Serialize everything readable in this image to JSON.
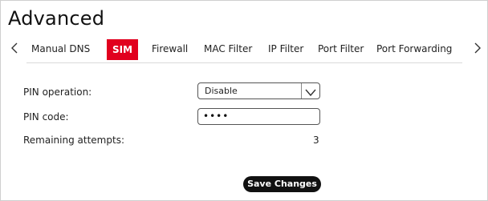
{
  "page": {
    "title": "Advanced"
  },
  "tabs": [
    {
      "label": "Manual DNS",
      "active": false
    },
    {
      "label": "SIM",
      "active": true
    },
    {
      "label": "Firewall",
      "active": false
    },
    {
      "label": "MAC Filter",
      "active": false
    },
    {
      "label": "IP Filter",
      "active": false
    },
    {
      "label": "Port Filter",
      "active": false
    },
    {
      "label": "Port Forwarding",
      "active": false
    }
  ],
  "nav": {
    "prev_icon": "chevron-left-icon",
    "next_icon": "chevron-right-icon"
  },
  "form": {
    "pin_operation_label": "PIN operation:",
    "pin_operation_value": "Disable",
    "pin_code_label": "PIN code:",
    "pin_code_value": "••••",
    "remaining_attempts_label": "Remaining attempts:",
    "remaining_attempts_value": "3"
  },
  "actions": {
    "save_label": "Save Changes"
  },
  "colors": {
    "active_tab_bg": "#e1001e",
    "button_bg": "#111111"
  }
}
